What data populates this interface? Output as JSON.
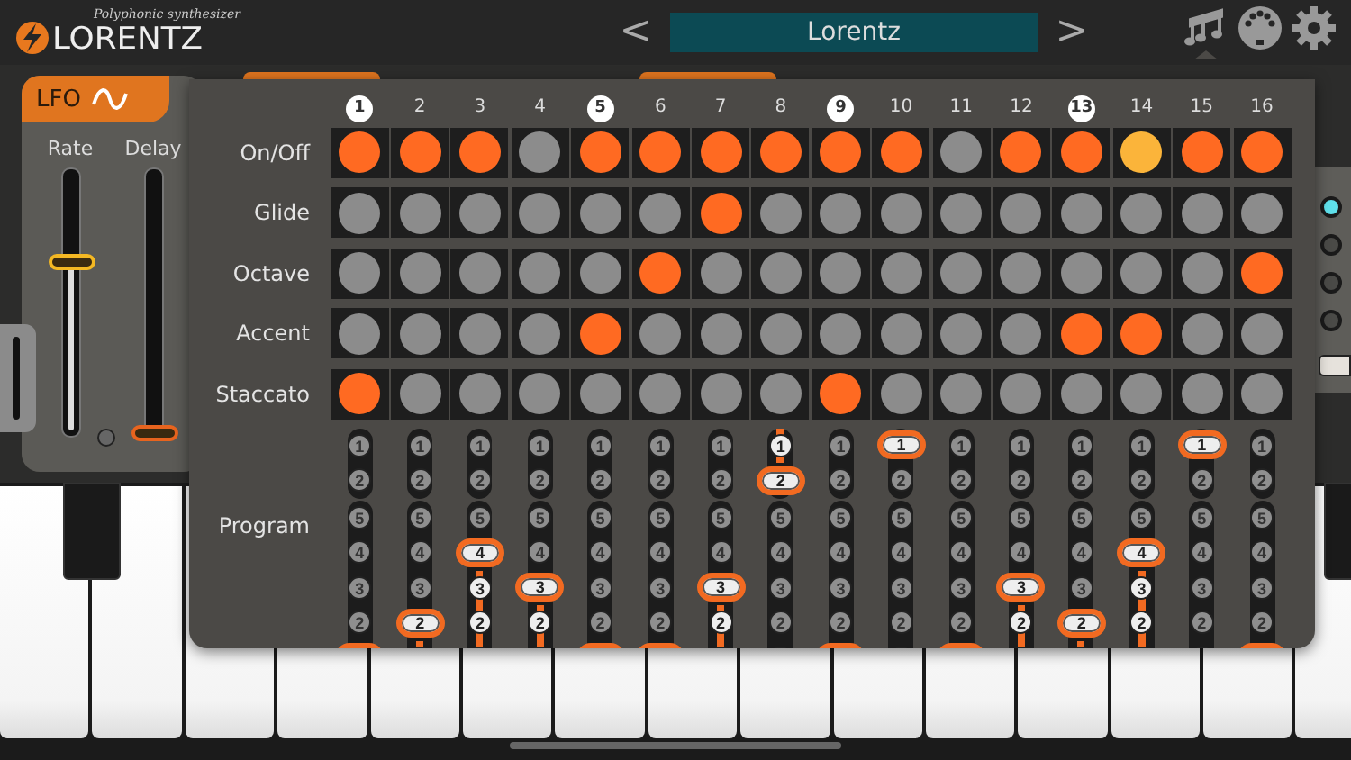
{
  "header": {
    "tagline": "Polyphonic synthesizer",
    "logo": "LORENTZ",
    "prev": "<",
    "preset": "Lorentz",
    "next": ">",
    "icons": [
      {
        "kind": "notes",
        "selected": true
      },
      {
        "kind": "midi",
        "selected": false
      },
      {
        "kind": "settings",
        "selected": false
      }
    ]
  },
  "lfo": {
    "title": "LFO",
    "sliders": [
      {
        "label": "Rate",
        "level": 0.68,
        "color": "#f4b823"
      },
      {
        "label": "Delay",
        "level": 0,
        "color": "#e8641e"
      }
    ]
  },
  "side_panel": {
    "options": [
      {
        "selected": true
      },
      {
        "selected": false
      },
      {
        "selected": false
      },
      {
        "selected": false
      }
    ]
  },
  "sequencer": {
    "steps": [
      {
        "label": "1",
        "marked": true,
        "playing": false
      },
      {
        "label": "2",
        "marked": false,
        "playing": false
      },
      {
        "label": "3",
        "marked": false,
        "playing": false
      },
      {
        "label": "4",
        "marked": false,
        "playing": false
      },
      {
        "label": "5",
        "marked": true,
        "playing": false
      },
      {
        "label": "6",
        "marked": false,
        "playing": false
      },
      {
        "label": "7",
        "marked": false,
        "playing": false
      },
      {
        "label": "8",
        "marked": false,
        "playing": false
      },
      {
        "label": "9",
        "marked": true,
        "playing": false
      },
      {
        "label": "10",
        "marked": false,
        "playing": false
      },
      {
        "label": "11",
        "marked": false,
        "playing": false
      },
      {
        "label": "12",
        "marked": false,
        "playing": false
      },
      {
        "label": "13",
        "marked": true,
        "playing": false
      },
      {
        "label": "14",
        "marked": false,
        "playing": true
      },
      {
        "label": "15",
        "marked": false,
        "playing": false
      },
      {
        "label": "16",
        "marked": false,
        "playing": false
      }
    ],
    "rows": [
      {
        "label": "On/Off",
        "cells": [
          true,
          true,
          true,
          false,
          true,
          true,
          true,
          true,
          true,
          true,
          false,
          true,
          true,
          true,
          true,
          true
        ]
      },
      {
        "label": "Glide",
        "cells": [
          false,
          false,
          false,
          false,
          false,
          false,
          true,
          false,
          false,
          false,
          false,
          false,
          false,
          false,
          false,
          false
        ]
      },
      {
        "label": "Octave",
        "cells": [
          false,
          false,
          false,
          false,
          false,
          true,
          false,
          false,
          false,
          false,
          false,
          false,
          false,
          false,
          false,
          true
        ]
      },
      {
        "label": "Accent",
        "cells": [
          false,
          false,
          false,
          false,
          true,
          false,
          false,
          false,
          false,
          false,
          false,
          false,
          true,
          true,
          false,
          false
        ]
      },
      {
        "label": "Staccato",
        "cells": [
          true,
          false,
          false,
          false,
          false,
          false,
          false,
          false,
          true,
          false,
          false,
          false,
          false,
          false,
          false,
          false
        ]
      }
    ],
    "program": {
      "label": "Program",
      "columns": [
        {
          "slots": [
            {
              "label": "1",
              "selected": false,
              "lit": false
            },
            {
              "label": "2",
              "selected": false,
              "lit": false
            },
            {
              "label": "5",
              "selected": false,
              "lit": false
            },
            {
              "label": "4",
              "selected": false,
              "lit": false
            },
            {
              "label": "3",
              "selected": false,
              "lit": false
            },
            {
              "label": "2",
              "selected": false,
              "lit": false
            }
          ],
          "bottom_selected": true,
          "bottom_lit": false
        },
        {
          "slots": [
            {
              "label": "1",
              "selected": false,
              "lit": false
            },
            {
              "label": "2",
              "selected": false,
              "lit": false
            },
            {
              "label": "5",
              "selected": false,
              "lit": false
            },
            {
              "label": "4",
              "selected": false,
              "lit": false
            },
            {
              "label": "3",
              "selected": false,
              "lit": false
            },
            {
              "label": "2",
              "selected": true,
              "lit": false
            }
          ],
          "bottom_selected": false,
          "bottom_lit": true
        },
        {
          "slots": [
            {
              "label": "1",
              "selected": false,
              "lit": false
            },
            {
              "label": "2",
              "selected": false,
              "lit": false
            },
            {
              "label": "5",
              "selected": false,
              "lit": false
            },
            {
              "label": "4",
              "selected": true,
              "lit": false
            },
            {
              "label": "3",
              "selected": false,
              "lit": true
            },
            {
              "label": "2",
              "selected": false,
              "lit": true
            }
          ],
          "bottom_selected": false,
          "bottom_lit": true
        },
        {
          "slots": [
            {
              "label": "1",
              "selected": false,
              "lit": false
            },
            {
              "label": "2",
              "selected": false,
              "lit": false
            },
            {
              "label": "5",
              "selected": false,
              "lit": false
            },
            {
              "label": "4",
              "selected": false,
              "lit": false
            },
            {
              "label": "3",
              "selected": true,
              "lit": false
            },
            {
              "label": "2",
              "selected": false,
              "lit": true
            }
          ],
          "bottom_selected": false,
          "bottom_lit": true
        },
        {
          "slots": [
            {
              "label": "1",
              "selected": false,
              "lit": false
            },
            {
              "label": "2",
              "selected": false,
              "lit": false
            },
            {
              "label": "5",
              "selected": false,
              "lit": false
            },
            {
              "label": "4",
              "selected": false,
              "lit": false
            },
            {
              "label": "3",
              "selected": false,
              "lit": false
            },
            {
              "label": "2",
              "selected": false,
              "lit": false
            }
          ],
          "bottom_selected": true,
          "bottom_lit": false
        },
        {
          "slots": [
            {
              "label": "1",
              "selected": false,
              "lit": false
            },
            {
              "label": "2",
              "selected": false,
              "lit": false
            },
            {
              "label": "5",
              "selected": false,
              "lit": false
            },
            {
              "label": "4",
              "selected": false,
              "lit": false
            },
            {
              "label": "3",
              "selected": false,
              "lit": false
            },
            {
              "label": "2",
              "selected": false,
              "lit": false
            }
          ],
          "bottom_selected": true,
          "bottom_lit": false
        },
        {
          "slots": [
            {
              "label": "1",
              "selected": false,
              "lit": false
            },
            {
              "label": "2",
              "selected": false,
              "lit": false
            },
            {
              "label": "5",
              "selected": false,
              "lit": false
            },
            {
              "label": "4",
              "selected": false,
              "lit": false
            },
            {
              "label": "3",
              "selected": true,
              "lit": false
            },
            {
              "label": "2",
              "selected": false,
              "lit": true
            }
          ],
          "bottom_selected": false,
          "bottom_lit": true
        },
        {
          "slots": [
            {
              "label": "1",
              "selected": false,
              "lit": true
            },
            {
              "label": "2",
              "selected": true,
              "lit": false
            },
            {
              "label": "5",
              "selected": false,
              "lit": false
            },
            {
              "label": "4",
              "selected": false,
              "lit": false
            },
            {
              "label": "3",
              "selected": false,
              "lit": false
            },
            {
              "label": "2",
              "selected": false,
              "lit": false
            }
          ],
          "bottom_selected": false,
          "bottom_lit": false
        },
        {
          "slots": [
            {
              "label": "1",
              "selected": false,
              "lit": false
            },
            {
              "label": "2",
              "selected": false,
              "lit": false
            },
            {
              "label": "5",
              "selected": false,
              "lit": false
            },
            {
              "label": "4",
              "selected": false,
              "lit": false
            },
            {
              "label": "3",
              "selected": false,
              "lit": false
            },
            {
              "label": "2",
              "selected": false,
              "lit": false
            }
          ],
          "bottom_selected": true,
          "bottom_lit": false
        },
        {
          "slots": [
            {
              "label": "1",
              "selected": true,
              "lit": false
            },
            {
              "label": "2",
              "selected": false,
              "lit": false
            },
            {
              "label": "5",
              "selected": false,
              "lit": false
            },
            {
              "label": "4",
              "selected": false,
              "lit": false
            },
            {
              "label": "3",
              "selected": false,
              "lit": false
            },
            {
              "label": "2",
              "selected": false,
              "lit": false
            }
          ],
          "bottom_selected": false,
          "bottom_lit": false
        },
        {
          "slots": [
            {
              "label": "1",
              "selected": false,
              "lit": false
            },
            {
              "label": "2",
              "selected": false,
              "lit": false
            },
            {
              "label": "5",
              "selected": false,
              "lit": false
            },
            {
              "label": "4",
              "selected": false,
              "lit": false
            },
            {
              "label": "3",
              "selected": false,
              "lit": false
            },
            {
              "label": "2",
              "selected": false,
              "lit": false
            }
          ],
          "bottom_selected": true,
          "bottom_lit": false
        },
        {
          "slots": [
            {
              "label": "1",
              "selected": false,
              "lit": false
            },
            {
              "label": "2",
              "selected": false,
              "lit": false
            },
            {
              "label": "5",
              "selected": false,
              "lit": false
            },
            {
              "label": "4",
              "selected": false,
              "lit": false
            },
            {
              "label": "3",
              "selected": true,
              "lit": false
            },
            {
              "label": "2",
              "selected": false,
              "lit": true
            }
          ],
          "bottom_selected": false,
          "bottom_lit": true
        },
        {
          "slots": [
            {
              "label": "1",
              "selected": false,
              "lit": false
            },
            {
              "label": "2",
              "selected": false,
              "lit": false
            },
            {
              "label": "5",
              "selected": false,
              "lit": false
            },
            {
              "label": "4",
              "selected": false,
              "lit": false
            },
            {
              "label": "3",
              "selected": false,
              "lit": false
            },
            {
              "label": "2",
              "selected": true,
              "lit": false
            }
          ],
          "bottom_selected": false,
          "bottom_lit": true
        },
        {
          "slots": [
            {
              "label": "1",
              "selected": false,
              "lit": false
            },
            {
              "label": "2",
              "selected": false,
              "lit": false
            },
            {
              "label": "5",
              "selected": false,
              "lit": false
            },
            {
              "label": "4",
              "selected": true,
              "lit": false
            },
            {
              "label": "3",
              "selected": false,
              "lit": true
            },
            {
              "label": "2",
              "selected": false,
              "lit": true
            }
          ],
          "bottom_selected": false,
          "bottom_lit": true
        },
        {
          "slots": [
            {
              "label": "1",
              "selected": true,
              "lit": false
            },
            {
              "label": "2",
              "selected": false,
              "lit": false
            },
            {
              "label": "5",
              "selected": false,
              "lit": false
            },
            {
              "label": "4",
              "selected": false,
              "lit": false
            },
            {
              "label": "3",
              "selected": false,
              "lit": false
            },
            {
              "label": "2",
              "selected": false,
              "lit": false
            }
          ],
          "bottom_selected": false,
          "bottom_lit": false
        },
        {
          "slots": [
            {
              "label": "1",
              "selected": false,
              "lit": false
            },
            {
              "label": "2",
              "selected": false,
              "lit": false
            },
            {
              "label": "5",
              "selected": false,
              "lit": false
            },
            {
              "label": "4",
              "selected": false,
              "lit": false
            },
            {
              "label": "3",
              "selected": false,
              "lit": false
            },
            {
              "label": "2",
              "selected": false,
              "lit": false
            }
          ],
          "bottom_selected": true,
          "bottom_lit": false
        }
      ]
    }
  }
}
